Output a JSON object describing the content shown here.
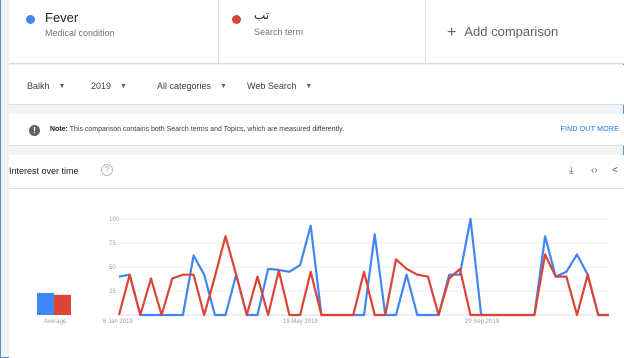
{
  "comparison": {
    "term1": {
      "name": "Fever",
      "type": "Medical condition",
      "color": "#4285f4"
    },
    "term2": {
      "name": "تب",
      "type": "Search term",
      "color": "#db4437"
    },
    "add_label": "Add comparison"
  },
  "filters": {
    "region": "Balkh",
    "time": "2019",
    "category": "All categories",
    "property": "Web Search"
  },
  "note": {
    "label": "Note:",
    "text": "This comparison contains both Search terms and Topics, which are measured differently.",
    "link": "FIND OUT MORE"
  },
  "card": {
    "title": "Interest over time",
    "help": "?",
    "download_icon": "download-icon",
    "embed_icon": "embed-icon",
    "share_icon": "share-icon"
  },
  "chart_data": {
    "type": "line",
    "y_ticks": [
      "100",
      "75",
      "50",
      "25"
    ],
    "ylim": [
      0,
      100
    ],
    "x_labels": [
      "6 Jan 2019",
      "19 May 2019",
      "29 Sep 2019"
    ],
    "average_label": "Average",
    "averages": [
      23,
      21
    ],
    "series": [
      {
        "name": "Fever",
        "color": "#4285f4",
        "values": [
          40,
          42,
          0,
          0,
          0,
          0,
          0,
          62,
          42,
          0,
          0,
          42,
          0,
          0,
          48,
          47,
          45,
          52,
          93,
          0,
          0,
          0,
          0,
          0,
          84,
          0,
          0,
          42,
          0,
          0,
          0,
          42,
          42,
          100,
          0,
          0,
          0,
          0,
          0,
          0,
          82,
          40,
          45,
          63,
          42,
          0,
          0
        ]
      },
      {
        "name": "تب",
        "color": "#db4437",
        "values": [
          0,
          42,
          0,
          38,
          0,
          38,
          42,
          42,
          0,
          40,
          82,
          42,
          0,
          40,
          0,
          46,
          0,
          0,
          45,
          0,
          0,
          0,
          0,
          45,
          0,
          0,
          58,
          48,
          42,
          40,
          0,
          38,
          48,
          0,
          0,
          0,
          0,
          0,
          0,
          0,
          63,
          40,
          40,
          0,
          42,
          0,
          0
        ]
      }
    ]
  }
}
